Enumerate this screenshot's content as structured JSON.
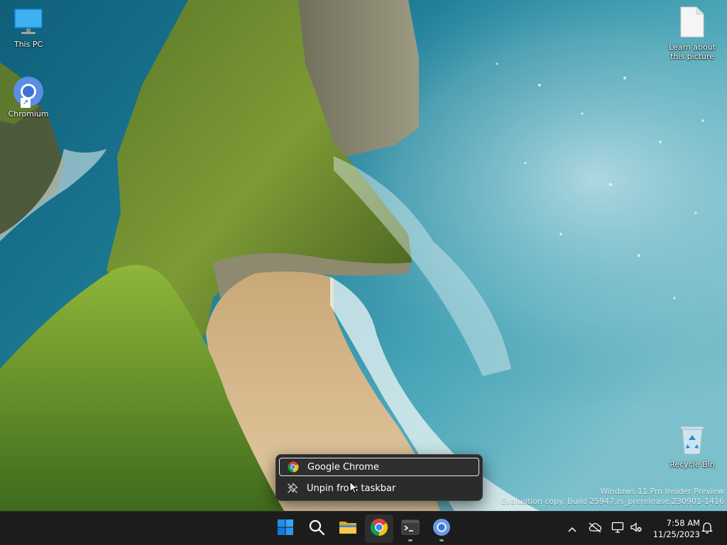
{
  "desktop": {
    "icons": [
      {
        "label": "This PC"
      },
      {
        "label": "Chromium"
      },
      {
        "label": "Learn about\nthis picture"
      },
      {
        "label": "Recycle Bin"
      }
    ],
    "watermark": {
      "line1": "Windows 11 Pro Insider Preview",
      "line2": "Evaluation copy. Build 25947.rs_prerelease.230901-1416"
    }
  },
  "jumplist": {
    "items": [
      {
        "label": "Google Chrome",
        "icon": "chrome-icon",
        "focused": true
      },
      {
        "label": "Unpin from taskbar",
        "icon": "unpin-icon",
        "focused": false
      }
    ]
  },
  "taskbar": {
    "apps": [
      {
        "name": "start",
        "icon": "windows-logo-icon"
      },
      {
        "name": "search",
        "icon": "search-icon"
      },
      {
        "name": "file-explorer",
        "icon": "folder-icon"
      },
      {
        "name": "google-chrome",
        "icon": "chrome-icon",
        "active": true
      },
      {
        "name": "terminal",
        "icon": "terminal-icon",
        "running": true
      },
      {
        "name": "chromium",
        "icon": "chromium-icon",
        "running": true
      }
    ],
    "tray": {
      "icons": [
        "chevron-up-icon",
        "onedrive-offline-icon",
        "network-icon",
        "volume-muted-icon",
        "notification-bell-icon"
      ]
    },
    "clock": {
      "time": "7:58 AM",
      "date": "11/25/2023"
    }
  },
  "colors": {
    "taskbar_bg": "#1c1c1c",
    "menu_bg": "#2b2b2b",
    "windows_blue": "#0f7ae5",
    "chrome_red": "#db4437",
    "chrome_yellow": "#f4c20d",
    "chrome_green": "#0f9d58",
    "chrome_blue": "#4285f4"
  }
}
